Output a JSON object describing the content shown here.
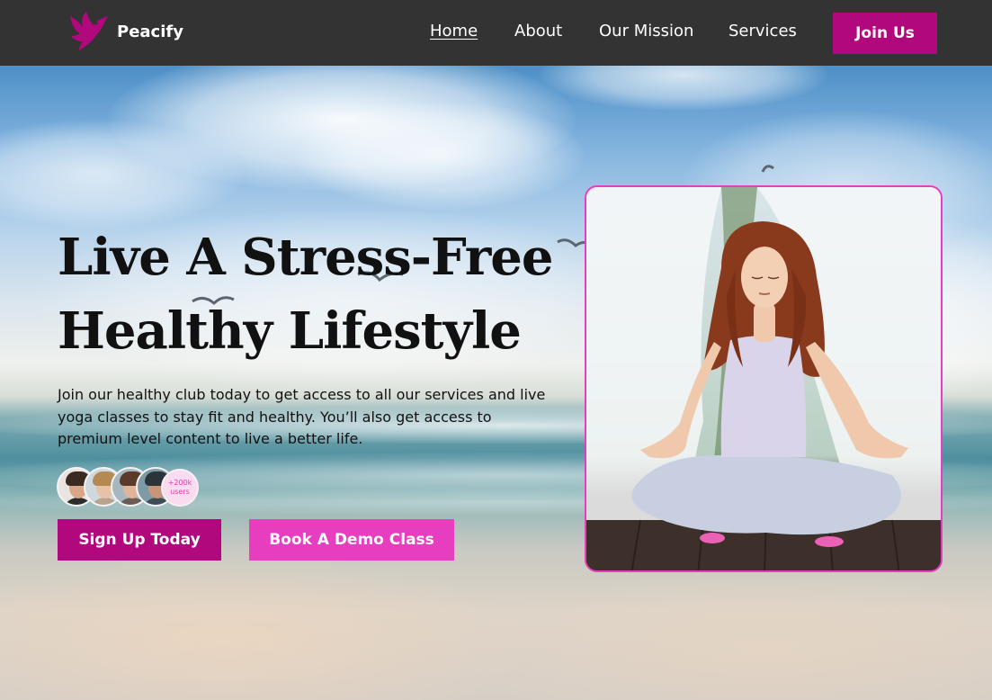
{
  "brand": {
    "name": "Peacify",
    "accent": "#b2087e",
    "accent_light": "#e73dbf",
    "logo_icon": "dove-icon"
  },
  "nav": {
    "links": [
      {
        "label": "Home",
        "active": true
      },
      {
        "label": "About",
        "active": false
      },
      {
        "label": "Our Mission",
        "active": false
      },
      {
        "label": "Services",
        "active": false
      }
    ],
    "cta_label": "Join Us"
  },
  "hero": {
    "headline_line1": "Live A Stress-Free",
    "headline_line2": "Healthy Lifestyle",
    "description": "Join our healthy club today to get access to all our services and live yoga classes to stay fit and healthy. You’ll also get access to premium level content to live a better life.",
    "users_count": "+200k",
    "users_label": "users",
    "primary_button": "Sign Up Today",
    "secondary_button": "Book A Demo Class"
  }
}
